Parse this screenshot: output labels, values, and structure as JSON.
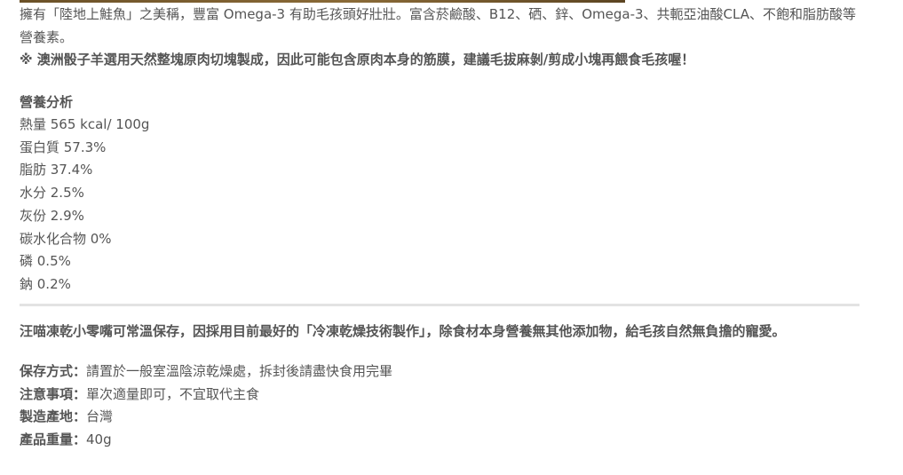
{
  "intro": {
    "paragraph": "擁有「陸地上鮭魚」之美稱，豐富 Omega-3 有助毛孩頭好壯壯。富含菸鹼酸、B12、硒、鋅、Omega-3、共軛亞油酸CLA、不飽和脂肪酸等營養素。",
    "note": "※ 澳洲骰子羊選用天然整塊原肉切塊製成，因此可能包含原肉本身的筋膜，建議毛拔麻剝/剪成小塊再餵食毛孩喔！"
  },
  "nutrition": {
    "heading": "營養分析",
    "items": [
      "熱量 565 kcal/ 100g",
      "蛋白質 57.3%",
      "脂肪 37.4%",
      "水分 2.5%",
      "灰份 2.9%",
      "碳水化合物 0%",
      "磷 0.5%",
      "鈉 0.2%"
    ]
  },
  "storage_note": "汪喵凍乾小零嘴可常溫保存，因採用目前最好的「冷凍乾燥技術製作」，除食材本身營養無其他添加物，給毛孩自然無負擔的寵愛。",
  "details": [
    {
      "key": "保存方式：",
      "value": "請置於一般室溫陰涼乾燥處，拆封後請盡快食用完畢"
    },
    {
      "key": "注意事項：",
      "value": "單次適量即可，不宜取代主食"
    },
    {
      "key": "製造產地：",
      "value": "台灣"
    },
    {
      "key": "產品重量：",
      "value": "40g"
    }
  ]
}
